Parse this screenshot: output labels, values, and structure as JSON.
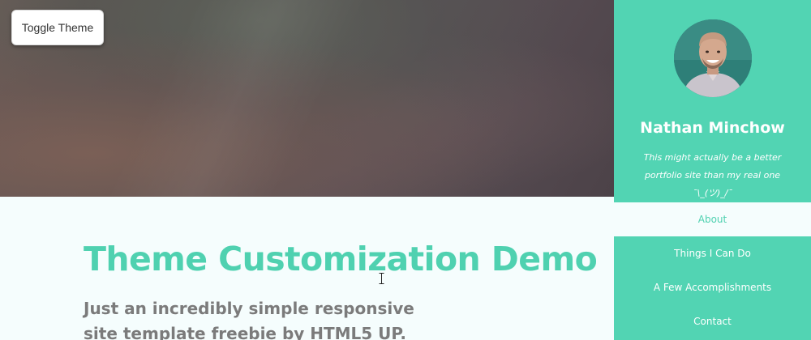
{
  "toolbar": {
    "toggle_label": "Toggle Theme"
  },
  "main": {
    "title": "Theme Customization Demo",
    "subtitle": "Just an incredibly simple responsive site template freebie by HTML5 UP."
  },
  "sidebar": {
    "name": "Nathan Minchow",
    "tagline": "This might actually be a better portfolio site than my real one ¯\\_(ツ)_/¯",
    "nav": [
      {
        "label": "About",
        "active": true
      },
      {
        "label": "Things I Can Do",
        "active": false
      },
      {
        "label": "A Few Accomplishments",
        "active": false
      },
      {
        "label": "Contact",
        "active": false
      }
    ]
  },
  "colors": {
    "accent": "#52d4b3",
    "title": "#4fd1b0",
    "page_bg": "#f5fdfd",
    "subtitle": "#7b7b7b"
  },
  "icons": {
    "cursor": "text-cursor-icon"
  }
}
